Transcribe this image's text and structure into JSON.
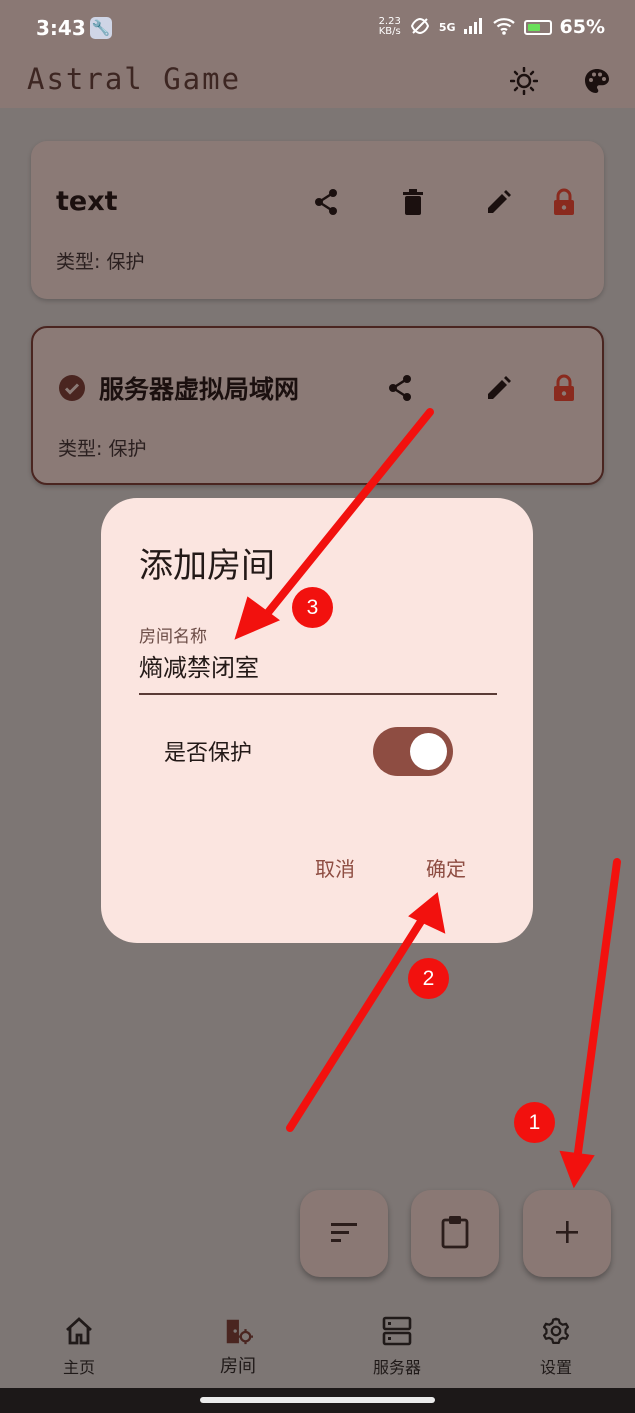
{
  "status_bar": {
    "time": "3:43",
    "net_speed_value": "2.23",
    "net_speed_unit": "KB/s",
    "signal": "5G",
    "battery": "65%"
  },
  "app_bar": {
    "title": "Astral Game",
    "icons": [
      "brightness-icon",
      "palette-icon"
    ]
  },
  "rooms": [
    {
      "name": "text",
      "type_label": "类型: 保护",
      "selected": false
    },
    {
      "name": "服务器虚拟局域网",
      "type_label": "类型: 保护",
      "selected": true
    }
  ],
  "dialog": {
    "title": "添加房间",
    "field_label": "房间名称",
    "field_value": "熵减禁闭室",
    "toggle_label": "是否保护",
    "toggle_on": true,
    "cancel_label": "取消",
    "confirm_label": "确定"
  },
  "fabs": [
    "sort-icon",
    "clipboard-icon",
    "add-icon"
  ],
  "nav": {
    "items": [
      {
        "label": "主页",
        "icon": "home-icon"
      },
      {
        "label": "房间",
        "icon": "room-icon"
      },
      {
        "label": "服务器",
        "icon": "server-icon"
      },
      {
        "label": "设置",
        "icon": "settings-icon"
      }
    ],
    "active_index": 1
  },
  "annotations": {
    "badges": [
      "1",
      "2",
      "3"
    ],
    "color": "#f2110e"
  },
  "colors": {
    "accent": "#8e4d42",
    "dialog_bg": "#fbe5e0",
    "scrim": "#7d7674",
    "lock_icon": "#8a2a1e"
  }
}
